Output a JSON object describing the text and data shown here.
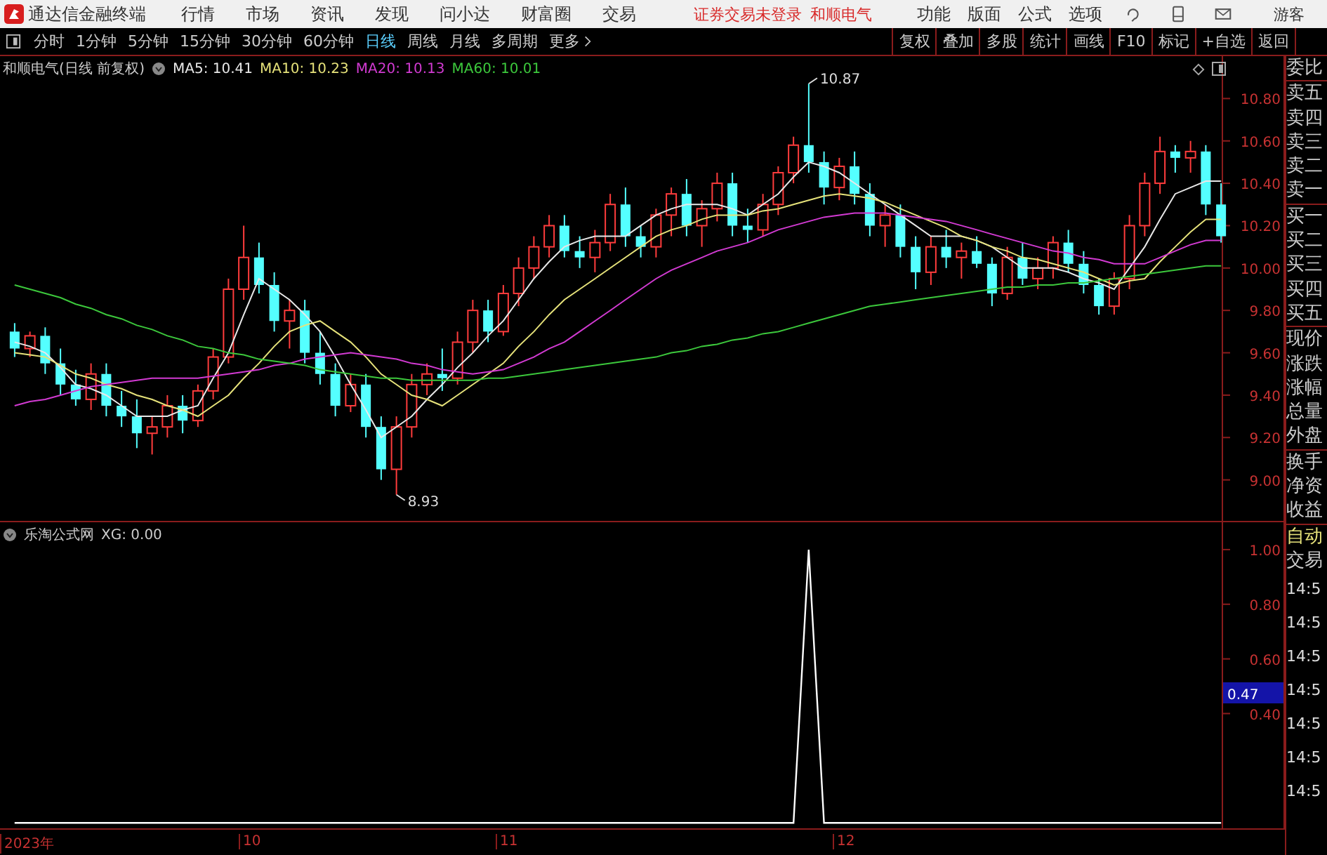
{
  "app_bar": {
    "title": "通达信金融终端",
    "menu": [
      "行情",
      "市场",
      "资讯",
      "发现",
      "问小达",
      "财富圈",
      "交易"
    ],
    "status": "证券交易未登录",
    "stock": "和顺电气",
    "menu_right": [
      "功能",
      "版面",
      "公式",
      "选项"
    ],
    "user": "游客"
  },
  "period_tabs": [
    {
      "label": "分时",
      "selected": false
    },
    {
      "label": "1分钟",
      "selected": false
    },
    {
      "label": "5分钟",
      "selected": false
    },
    {
      "label": "15分钟",
      "selected": false
    },
    {
      "label": "30分钟",
      "selected": false
    },
    {
      "label": "60分钟",
      "selected": false
    },
    {
      "label": "日线",
      "selected": true
    },
    {
      "label": "周线",
      "selected": false
    },
    {
      "label": "月线",
      "selected": false
    },
    {
      "label": "多周期",
      "selected": false
    },
    {
      "label": "更多",
      "selected": false
    }
  ],
  "tools": [
    "复权",
    "叠加",
    "多股",
    "统计",
    "画线",
    "F10",
    "标记",
    "+自选",
    "返回"
  ],
  "price_chart": {
    "title": "和顺电气(日线 前复权)",
    "ma": [
      {
        "name": "MA5: 10.41",
        "color": "#e8e8e8"
      },
      {
        "name": "MA10: 10.23",
        "color": "#e6e27a"
      },
      {
        "name": "MA20: 10.13",
        "color": "#d23ad2"
      },
      {
        "name": "MA60: 10.01",
        "color": "#3cc83c"
      }
    ],
    "high_label": "10.87",
    "low_label": "8.93",
    "chart_data": {
      "type": "candlestick",
      "ylim": [
        8.8,
        11.0
      ],
      "ohlc": [
        [
          9.7,
          9.74,
          9.58,
          9.62
        ],
        [
          9.62,
          9.7,
          9.58,
          9.68
        ],
        [
          9.68,
          9.72,
          9.5,
          9.55
        ],
        [
          9.55,
          9.62,
          9.4,
          9.45
        ],
        [
          9.45,
          9.52,
          9.35,
          9.38
        ],
        [
          9.38,
          9.55,
          9.33,
          9.5
        ],
        [
          9.5,
          9.55,
          9.3,
          9.35
        ],
        [
          9.35,
          9.42,
          9.25,
          9.3
        ],
        [
          9.3,
          9.38,
          9.15,
          9.22
        ],
        [
          9.22,
          9.3,
          9.12,
          9.25
        ],
        [
          9.25,
          9.4,
          9.2,
          9.35
        ],
        [
          9.35,
          9.4,
          9.22,
          9.28
        ],
        [
          9.28,
          9.45,
          9.25,
          9.42
        ],
        [
          9.42,
          9.62,
          9.38,
          9.58
        ],
        [
          9.58,
          9.95,
          9.55,
          9.9
        ],
        [
          9.9,
          10.2,
          9.85,
          10.05
        ],
        [
          10.05,
          10.12,
          9.88,
          9.92
        ],
        [
          9.92,
          9.98,
          9.7,
          9.75
        ],
        [
          9.75,
          9.85,
          9.62,
          9.8
        ],
        [
          9.8,
          9.85,
          9.55,
          9.6
        ],
        [
          9.6,
          9.7,
          9.45,
          9.5
        ],
        [
          9.5,
          9.55,
          9.3,
          9.35
        ],
        [
          9.35,
          9.5,
          9.32,
          9.45
        ],
        [
          9.45,
          9.5,
          9.2,
          9.25
        ],
        [
          9.25,
          9.3,
          9.0,
          9.05
        ],
        [
          9.05,
          9.3,
          8.93,
          9.25
        ],
        [
          9.25,
          9.5,
          9.2,
          9.45
        ],
        [
          9.45,
          9.55,
          9.4,
          9.5
        ],
        [
          9.5,
          9.62,
          9.42,
          9.48
        ],
        [
          9.48,
          9.7,
          9.45,
          9.65
        ],
        [
          9.65,
          9.85,
          9.6,
          9.8
        ],
        [
          9.8,
          9.85,
          9.65,
          9.7
        ],
        [
          9.7,
          9.92,
          9.68,
          9.88
        ],
        [
          9.88,
          10.05,
          9.82,
          10.0
        ],
        [
          10.0,
          10.15,
          9.95,
          10.1
        ],
        [
          10.1,
          10.25,
          10.05,
          10.2
        ],
        [
          10.2,
          10.25,
          10.05,
          10.08
        ],
        [
          10.08,
          10.15,
          10.0,
          10.05
        ],
        [
          10.05,
          10.18,
          9.98,
          10.12
        ],
        [
          10.12,
          10.35,
          10.08,
          10.3
        ],
        [
          10.3,
          10.38,
          10.1,
          10.15
        ],
        [
          10.15,
          10.2,
          10.05,
          10.1
        ],
        [
          10.1,
          10.28,
          10.05,
          10.25
        ],
        [
          10.25,
          10.38,
          10.15,
          10.35
        ],
        [
          10.35,
          10.42,
          10.15,
          10.2
        ],
        [
          10.2,
          10.32,
          10.1,
          10.28
        ],
        [
          10.28,
          10.45,
          10.22,
          10.4
        ],
        [
          10.4,
          10.45,
          10.15,
          10.2
        ],
        [
          10.2,
          10.28,
          10.12,
          10.18
        ],
        [
          10.18,
          10.35,
          10.15,
          10.3
        ],
        [
          10.3,
          10.48,
          10.25,
          10.45
        ],
        [
          10.45,
          10.62,
          10.4,
          10.58
        ],
        [
          10.58,
          10.87,
          10.45,
          10.5
        ],
        [
          10.5,
          10.55,
          10.3,
          10.38
        ],
        [
          10.38,
          10.52,
          10.32,
          10.48
        ],
        [
          10.48,
          10.55,
          10.3,
          10.35
        ],
        [
          10.35,
          10.4,
          10.15,
          10.2
        ],
        [
          10.2,
          10.3,
          10.1,
          10.25
        ],
        [
          10.25,
          10.3,
          10.05,
          10.1
        ],
        [
          10.1,
          10.15,
          9.9,
          9.98
        ],
        [
          9.98,
          10.15,
          9.92,
          10.1
        ],
        [
          10.1,
          10.18,
          10.0,
          10.05
        ],
        [
          10.05,
          10.12,
          9.95,
          10.08
        ],
        [
          10.08,
          10.15,
          10.0,
          10.02
        ],
        [
          10.02,
          10.05,
          9.82,
          9.88
        ],
        [
          9.88,
          10.1,
          9.85,
          10.05
        ],
        [
          10.05,
          10.12,
          9.92,
          9.95
        ],
        [
          9.95,
          10.05,
          9.9,
          10.0
        ],
        [
          10.0,
          10.15,
          9.95,
          10.12
        ],
        [
          10.12,
          10.18,
          9.98,
          10.02
        ],
        [
          10.02,
          10.08,
          9.88,
          9.92
        ],
        [
          9.92,
          9.95,
          9.78,
          9.82
        ],
        [
          9.82,
          9.98,
          9.78,
          9.95
        ],
        [
          9.95,
          10.25,
          9.9,
          10.2
        ],
        [
          10.2,
          10.45,
          10.15,
          10.4
        ],
        [
          10.4,
          10.62,
          10.35,
          10.55
        ],
        [
          10.55,
          10.58,
          10.45,
          10.52
        ],
        [
          10.52,
          10.6,
          10.45,
          10.55
        ],
        [
          10.55,
          10.58,
          10.25,
          10.3
        ],
        [
          10.3,
          10.4,
          10.12,
          10.15
        ]
      ],
      "yticks": [
        {
          "value": 10.8,
          "label": "10.80"
        },
        {
          "value": 10.6,
          "label": "10.60"
        },
        {
          "value": 10.4,
          "label": "10.40"
        },
        {
          "value": 10.2,
          "label": "10.20"
        },
        {
          "value": 10.0,
          "label": "10.00"
        },
        {
          "value": 9.8,
          "label": "9.80"
        },
        {
          "value": 9.6,
          "label": "9.60"
        },
        {
          "value": 9.4,
          "label": "9.40"
        },
        {
          "value": 9.2,
          "label": "9.20"
        },
        {
          "value": 9.0,
          "label": "9.00"
        }
      ],
      "series": [
        {
          "type": "line",
          "color": "#e8e8e8",
          "values": [
            9.65,
            9.63,
            9.6,
            9.53,
            9.45,
            9.43,
            9.4,
            9.35,
            9.3,
            9.3,
            9.3,
            9.33,
            9.35,
            9.48,
            9.6,
            9.78,
            9.95,
            9.9,
            9.85,
            9.78,
            9.7,
            9.58,
            9.45,
            9.33,
            9.2,
            9.25,
            9.3,
            9.38,
            9.45,
            9.53,
            9.6,
            9.68,
            9.75,
            9.85,
            9.95,
            10.03,
            10.1,
            10.13,
            10.15,
            10.15,
            10.15,
            10.2,
            10.25,
            10.28,
            10.3,
            10.3,
            10.3,
            10.28,
            10.25,
            10.3,
            10.35,
            10.43,
            10.5,
            10.48,
            10.45,
            10.4,
            10.35,
            10.3,
            10.25,
            10.2,
            10.15,
            10.15,
            10.15,
            10.13,
            10.1,
            10.05,
            10.0,
            10.0,
            10.0,
            9.98,
            9.95,
            9.93,
            9.9,
            10.0,
            10.1,
            10.23,
            10.35,
            10.38,
            10.41,
            10.41
          ]
        },
        {
          "type": "line",
          "color": "#e6e27a",
          "values": [
            9.6,
            9.59,
            9.58,
            9.54,
            9.5,
            9.48,
            9.45,
            9.43,
            9.4,
            9.38,
            9.35,
            9.33,
            9.3,
            9.35,
            9.4,
            9.48,
            9.55,
            9.63,
            9.7,
            9.73,
            9.75,
            9.7,
            9.65,
            9.58,
            9.5,
            9.45,
            9.4,
            9.38,
            9.35,
            9.4,
            9.45,
            9.5,
            9.55,
            9.63,
            9.7,
            9.78,
            9.85,
            9.9,
            9.95,
            10.0,
            10.05,
            10.1,
            10.15,
            10.18,
            10.2,
            10.23,
            10.25,
            10.25,
            10.25,
            10.27,
            10.28,
            10.3,
            10.32,
            10.34,
            10.35,
            10.34,
            10.33,
            10.31,
            10.28,
            10.25,
            10.22,
            10.19,
            10.15,
            10.13,
            10.1,
            10.08,
            10.05,
            10.04,
            10.02,
            10.0,
            9.98,
            9.95,
            9.92,
            9.94,
            9.95,
            10.03,
            10.1,
            10.17,
            10.23,
            10.23
          ]
        },
        {
          "type": "line",
          "color": "#d23ad2",
          "values": [
            9.35,
            9.37,
            9.38,
            9.4,
            9.42,
            9.44,
            9.45,
            9.46,
            9.47,
            9.48,
            9.48,
            9.48,
            9.48,
            9.49,
            9.5,
            9.51,
            9.52,
            9.54,
            9.55,
            9.57,
            9.58,
            9.59,
            9.6,
            9.59,
            9.58,
            9.57,
            9.55,
            9.54,
            9.52,
            9.51,
            9.5,
            9.51,
            9.52,
            9.55,
            9.58,
            9.62,
            9.65,
            9.7,
            9.75,
            9.8,
            9.85,
            9.9,
            9.95,
            9.99,
            10.02,
            10.05,
            10.08,
            10.1,
            10.12,
            10.15,
            10.18,
            10.2,
            10.22,
            10.24,
            10.25,
            10.26,
            10.26,
            10.26,
            10.25,
            10.24,
            10.23,
            10.22,
            10.2,
            10.18,
            10.16,
            10.14,
            10.12,
            10.1,
            10.08,
            10.07,
            10.05,
            10.04,
            10.02,
            10.02,
            10.02,
            10.05,
            10.08,
            10.11,
            10.13,
            10.13
          ]
        },
        {
          "type": "line",
          "color": "#3cc83c",
          "values": [
            9.92,
            9.9,
            9.88,
            9.86,
            9.83,
            9.81,
            9.78,
            9.76,
            9.73,
            9.71,
            9.68,
            9.66,
            9.63,
            9.62,
            9.6,
            9.59,
            9.57,
            9.56,
            9.55,
            9.54,
            9.52,
            9.51,
            9.5,
            9.49,
            9.48,
            9.48,
            9.47,
            9.47,
            9.47,
            9.47,
            9.47,
            9.48,
            9.48,
            9.49,
            9.5,
            9.51,
            9.52,
            9.53,
            9.54,
            9.55,
            9.56,
            9.57,
            9.58,
            9.6,
            9.61,
            9.63,
            9.64,
            9.66,
            9.67,
            9.69,
            9.7,
            9.72,
            9.74,
            9.76,
            9.78,
            9.8,
            9.82,
            9.83,
            9.84,
            9.85,
            9.86,
            9.87,
            9.88,
            9.89,
            9.9,
            9.91,
            9.91,
            9.92,
            9.92,
            9.93,
            9.93,
            9.94,
            9.95,
            9.96,
            9.97,
            9.98,
            9.99,
            10.0,
            10.01,
            10.01
          ]
        }
      ]
    }
  },
  "indicator": {
    "title": "乐淘公式网",
    "reading": "XG: 0.00",
    "cursor_value": "0.47",
    "chart_data": {
      "type": "line",
      "ylim": [
        -0.02,
        1.1
      ],
      "yticks": [
        {
          "value": 1,
          "label": "1.00"
        },
        {
          "value": 0.8,
          "label": "0.80"
        },
        {
          "value": 0.6,
          "label": "0.60"
        },
        {
          "value": 0.4,
          "label": "0.40"
        }
      ],
      "series": [
        {
          "color": "#ffffff",
          "values": [
            0,
            0,
            0,
            0,
            0,
            0,
            0,
            0,
            0,
            0,
            0,
            0,
            0,
            0,
            0,
            0,
            0,
            0,
            0,
            0,
            0,
            0,
            0,
            0,
            0,
            0,
            0,
            0,
            0,
            0,
            0,
            0,
            0,
            0,
            0,
            0,
            0,
            0,
            0,
            0,
            0,
            0,
            0,
            0,
            0,
            0,
            0,
            0,
            0,
            0,
            0,
            0,
            1,
            0,
            0,
            0,
            0,
            0,
            0,
            0,
            0,
            0,
            0,
            0,
            0,
            0,
            0,
            0,
            0,
            0,
            0,
            0,
            0,
            0,
            0,
            0,
            0,
            0,
            0,
            0
          ]
        }
      ]
    }
  },
  "x_axis": [
    "2023年",
    "10",
    "11",
    "12"
  ],
  "quote_panel": {
    "labels": [
      [
        "委比"
      ],
      [
        "卖五",
        "卖四",
        "卖三",
        "卖二",
        "卖一"
      ],
      [
        "买一",
        "买二",
        "买三",
        "买四",
        "买五"
      ],
      [
        "现价",
        "涨跌",
        "涨幅",
        "总量",
        "外盘"
      ],
      [
        "换手",
        "净资",
        "收益"
      ]
    ],
    "auto_label": "自动",
    "trade_label": "交易",
    "times": [
      "14:5",
      "14:5",
      "14:5",
      "14:5",
      "14:5",
      "14:5",
      "14:5"
    ]
  }
}
